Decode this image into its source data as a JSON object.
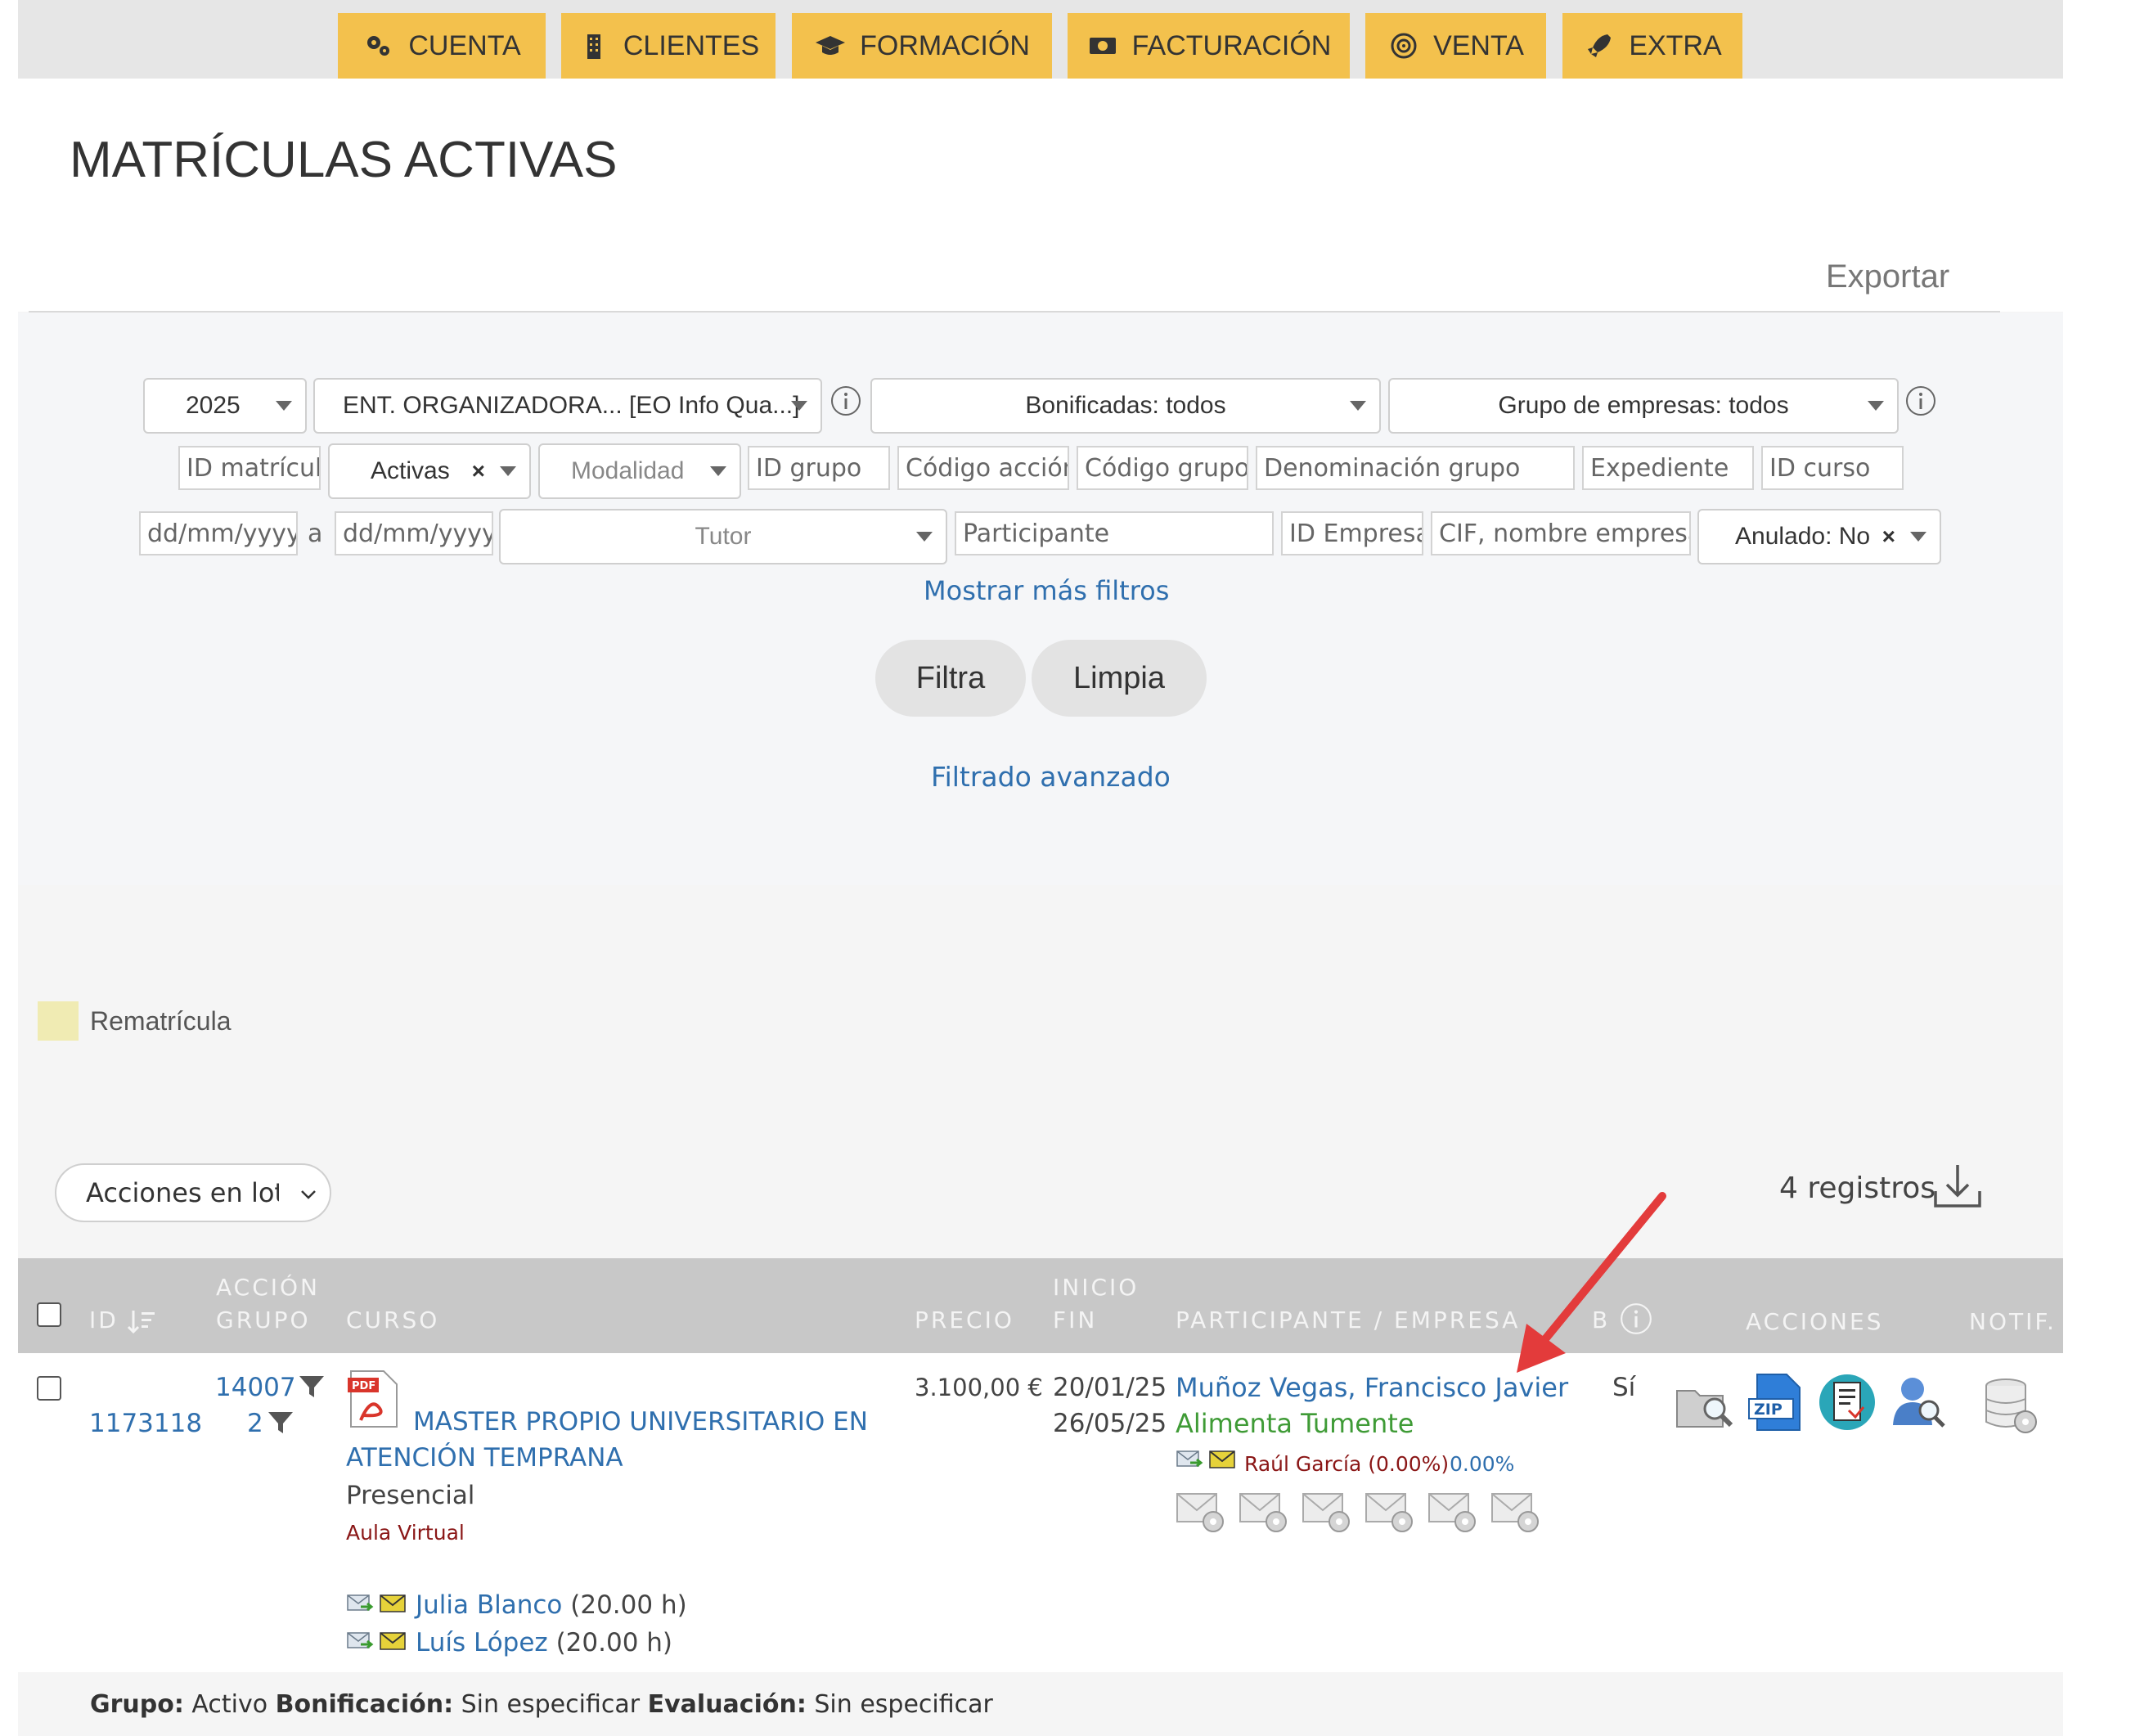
{
  "nav": {
    "items": [
      {
        "label": "CUENTA",
        "icon": "gears-icon"
      },
      {
        "label": "CLIENTES",
        "icon": "building-icon"
      },
      {
        "label": "FORMACIÓN",
        "icon": "graduation-cap-icon"
      },
      {
        "label": "FACTURACIÓN",
        "icon": "money-icon"
      },
      {
        "label": "VENTA",
        "icon": "target-icon"
      },
      {
        "label": "EXTRA",
        "icon": "rocket-icon"
      }
    ],
    "accent_color": "#f3c14d"
  },
  "page": {
    "title": "MATRÍCULAS ACTIVAS",
    "export_label": "Exportar"
  },
  "filters": {
    "year": "2025",
    "entity": "ENT. ORGANIZADORA... [EO Info Qua...]",
    "bonificadas": "Bonificadas: todos",
    "grupo_empresas": "Grupo de empresas: todos",
    "id_matricula_placeholder": "ID matrícula",
    "estado": "Activas",
    "modalidad_placeholder": "Modalidad",
    "id_grupo_placeholder": "ID grupo",
    "codigo_accion_placeholder": "Código acción",
    "codigo_grupo_placeholder": "Código grupo",
    "denominacion_placeholder": "Denominación grupo",
    "expediente_placeholder": "Expediente",
    "id_curso_placeholder": "ID curso",
    "date_from_placeholder": "dd/mm/yyyy",
    "date_sep": "a",
    "date_to_placeholder": "dd/mm/yyyy",
    "tutor_placeholder": "Tutor",
    "participante_placeholder": "Participante",
    "id_empresa_placeholder": "ID Empresa",
    "cif_placeholder": "CIF, nombre empresa",
    "anulado": "Anulado: No",
    "more_filters": "Mostrar más filtros",
    "filter_button": "Filtra",
    "clear_button": "Limpia",
    "advanced": "Filtrado avanzado"
  },
  "legend": {
    "rematricula_label": "Rematrícula",
    "rematricula_color": "#f0ebb3"
  },
  "toolbar": {
    "bulk_actions": "Acciones en lote",
    "records": "4 registros"
  },
  "table": {
    "headers": {
      "id": "ID",
      "accion": "ACCIÓN",
      "grupo": "GRUPO",
      "curso": "CURSO",
      "precio": "PRECIO",
      "inicio": "INICIO",
      "fin": "FIN",
      "participante": "PARTICIPANTE / EMPRESA",
      "b": "B",
      "acciones": "ACCIONES",
      "notif": "NOTIF."
    },
    "row": {
      "id": "1173118",
      "accion": "14007",
      "grupo": "2",
      "curso_title_1": "MASTER PROPIO UNIVERSITARIO EN",
      "curso_title_2": "ATENCIÓN TEMPRANA",
      "modalidad": "Presencial",
      "aula": "Aula Virtual",
      "tutors": [
        {
          "name": "Julia Blanco",
          "hours": "(20.00 h)"
        },
        {
          "name": "Luís López",
          "hours": "(20.00 h)"
        }
      ],
      "precio": "3.100,00 €",
      "inicio": "20/01/25",
      "fin": "26/05/25",
      "participante": "Muñoz Vegas, Francisco Javier",
      "empresa": "Alimenta Tumente",
      "comercial": "Raúl García (0.00%)",
      "percent": "0.00%",
      "bonificada": "Sí"
    }
  },
  "footer": {
    "grupo_label": "Grupo:",
    "grupo_value": "Activo",
    "bonif_label": "Bonificación:",
    "bonif_value": "Sin especificar",
    "eval_label": "Evaluación:",
    "eval_value": "Sin especificar"
  }
}
